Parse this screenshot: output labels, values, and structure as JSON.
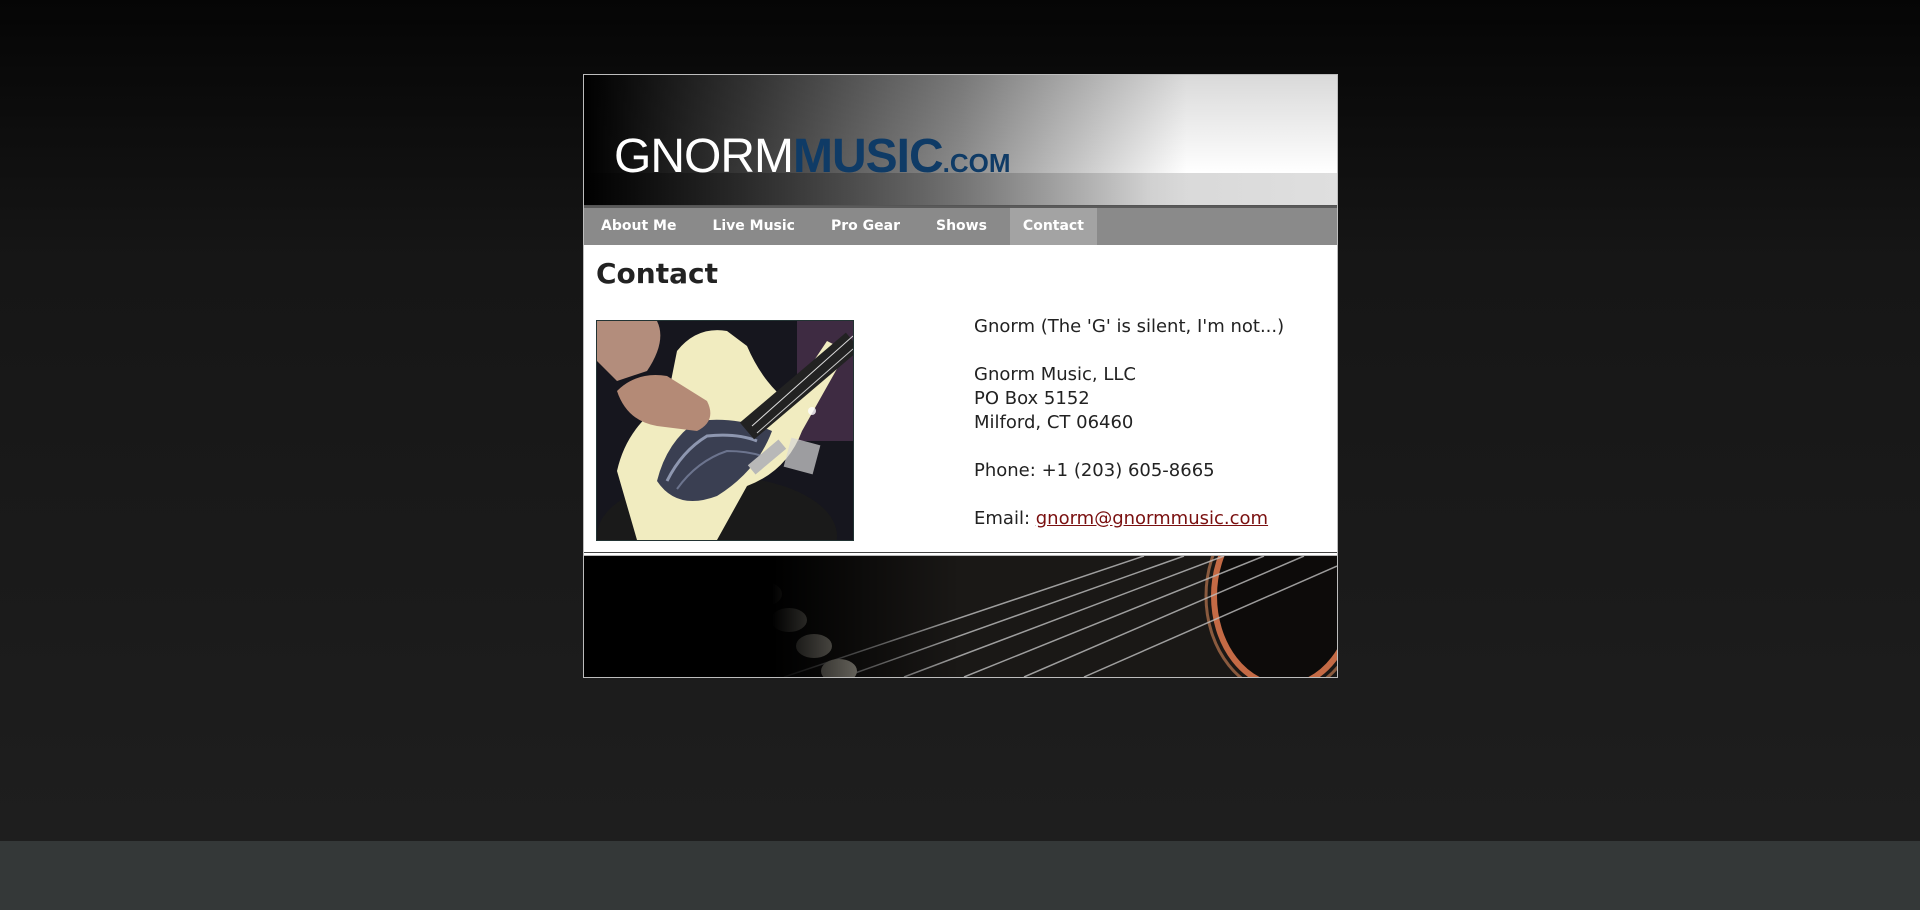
{
  "logo": {
    "part1": "GNORM",
    "part2": "MUSIC",
    "part3": ".COM"
  },
  "nav": {
    "items": [
      {
        "label": "About Me"
      },
      {
        "label": "Live Music"
      },
      {
        "label": "Pro Gear"
      },
      {
        "label": "Shows"
      },
      {
        "label": "Contact"
      }
    ],
    "active": "Contact"
  },
  "content": {
    "title": "Contact",
    "name_line": "Gnorm (The 'G' is silent, I'm not...)",
    "company": "Gnorm Music, LLC",
    "address1": "PO Box 5152",
    "address2": "Milford, CT 06460",
    "phone_label": "Phone:",
    "phone": "+1 (203) 605-8665",
    "email_label": "Email:",
    "email": "gnorm@gnormmusic.com"
  },
  "colors": {
    "nav_bg": "#8a8a8a",
    "nav_active": "#a3a3a3",
    "logo_blue": "#0f3b66",
    "link": "#7a1010"
  }
}
